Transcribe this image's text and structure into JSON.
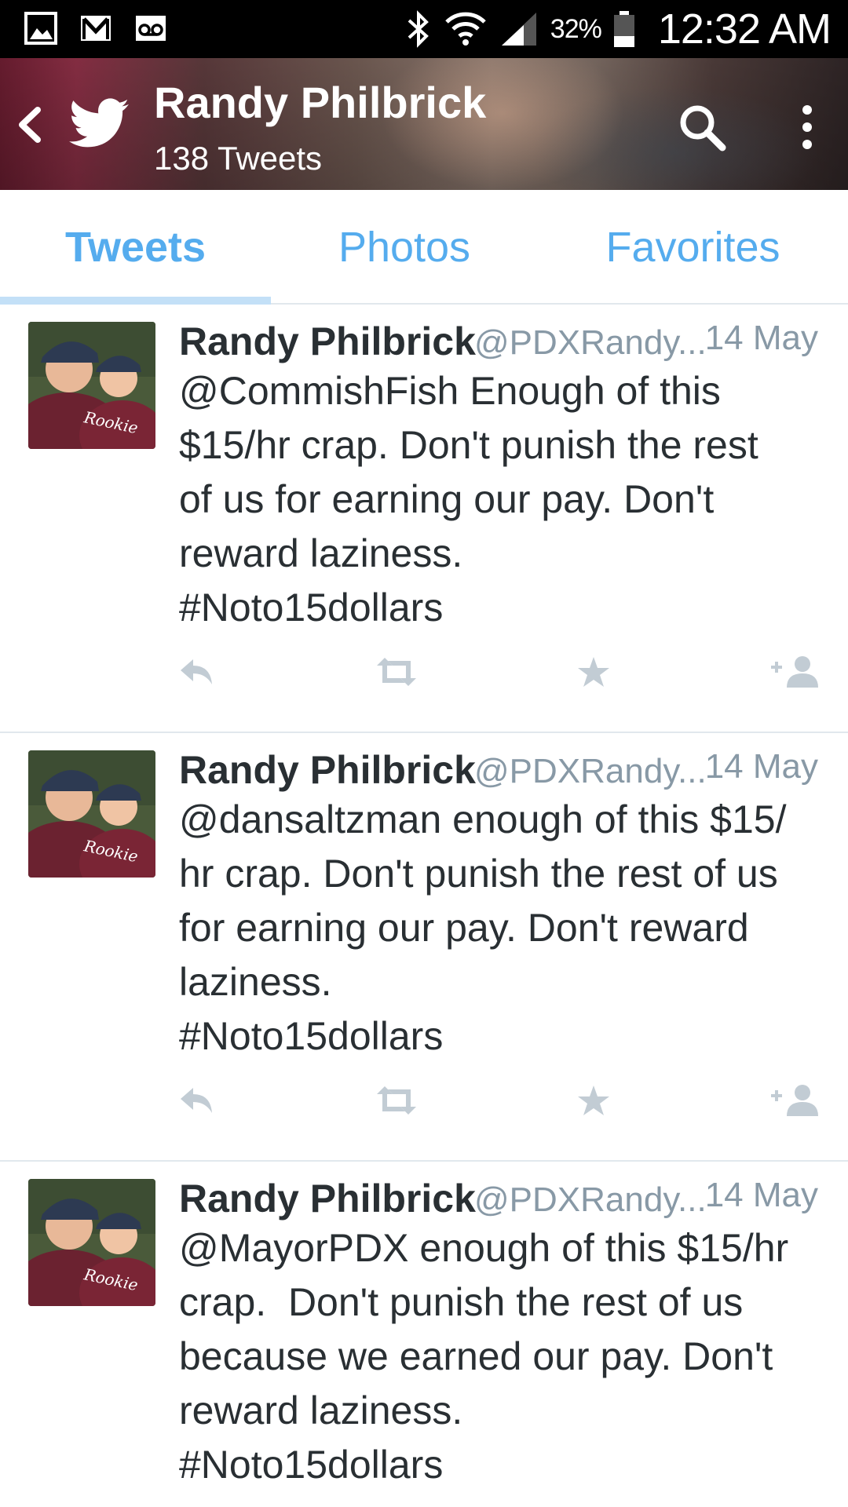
{
  "status_bar": {
    "notification_icons": [
      "gallery-icon",
      "gmail-icon",
      "voicemail-icon"
    ],
    "system_icons": [
      "bluetooth-icon",
      "wifi-icon",
      "signal-icon",
      "battery-icon"
    ],
    "battery": "32%",
    "time": "12:32 AM"
  },
  "header": {
    "name": "Randy Philbrick",
    "tweet_count": "138 Tweets"
  },
  "tabs": [
    {
      "label": "Tweets",
      "active": true
    },
    {
      "label": "Photos",
      "active": false
    },
    {
      "label": "Favorites",
      "active": false
    }
  ],
  "colors": {
    "accent": "#55acee",
    "muted": "#8899a6",
    "action_icon": "#c2ccd4",
    "divider": "#e1e8ed"
  },
  "tweets": [
    {
      "name": "Randy Philbrick",
      "handle": "@PDXRandy...",
      "date": "14 May",
      "lines": [
        "@CommishFish Enough of this",
        "$15/hr crap. Don't punish the rest",
        "of us for earning our pay. Don't",
        "reward laziness.",
        "#Noto15dollars"
      ],
      "avatar_caption": "Rookie"
    },
    {
      "name": "Randy Philbrick",
      "handle": "@PDXRandy...",
      "date": "14 May",
      "lines": [
        "@dansaltzman enough of this $15/",
        "hr crap. Don't punish the rest of us",
        "for earning our pay. Don't reward",
        "laziness.",
        "#Noto15dollars"
      ],
      "avatar_caption": "Rookie"
    },
    {
      "name": "Randy Philbrick",
      "handle": "@PDXRandy...",
      "date": "14 May",
      "lines": [
        "@MayorPDX enough of this $15/hr",
        "crap.  Don't punish the rest of us",
        "because we earned our pay. Don't",
        "reward laziness.",
        "#Noto15dollars"
      ],
      "avatar_caption": "Rookie"
    }
  ],
  "tweet_actions": [
    "reply-icon",
    "retweet-icon",
    "favorite-icon",
    "follow-icon"
  ]
}
